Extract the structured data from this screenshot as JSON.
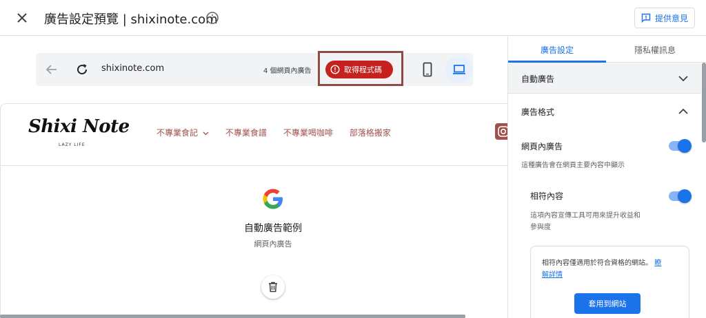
{
  "header": {
    "title": "廣告設定預覽 | shixinote.com",
    "feedback_label": "提供意見"
  },
  "toolbar": {
    "url": "shixinote.com",
    "ads_count": "4 個網頁內廣告",
    "get_code_label": "取得程式碼"
  },
  "site": {
    "logo": "Shixi Note",
    "logo_sub": "LAZY LIFE",
    "nav": [
      "不專業食記",
      "不專業食譜",
      "不專業喝咖啡",
      "部落格搬家"
    ]
  },
  "example": {
    "title": "自動廣告範例",
    "subtitle": "網頁內廣告"
  },
  "panel": {
    "tabs": [
      "廣告設定",
      "隱私權訊息"
    ],
    "active_tab": 0,
    "auto_ads_title": "自動廣告",
    "ad_formats_title": "廣告格式",
    "inpage_label": "網頁內廣告",
    "inpage_desc": "這種廣告會在網頁主要內容中顯示",
    "inpage_on": true,
    "matched_label": "相符內容",
    "matched_desc_1": "這項內容宣傳工具可用來提升收益和",
    "matched_desc_2": "參與度",
    "matched_on": true,
    "notice_text": "相符內容僅適用於符合資格的網站。",
    "notice_link_1": "瞭",
    "notice_link_2": "解詳情",
    "apply_label": "套用到網站"
  },
  "colors": {
    "accent": "#1a73e8",
    "danger": "#c5221f",
    "nav_text": "#a0524a"
  }
}
